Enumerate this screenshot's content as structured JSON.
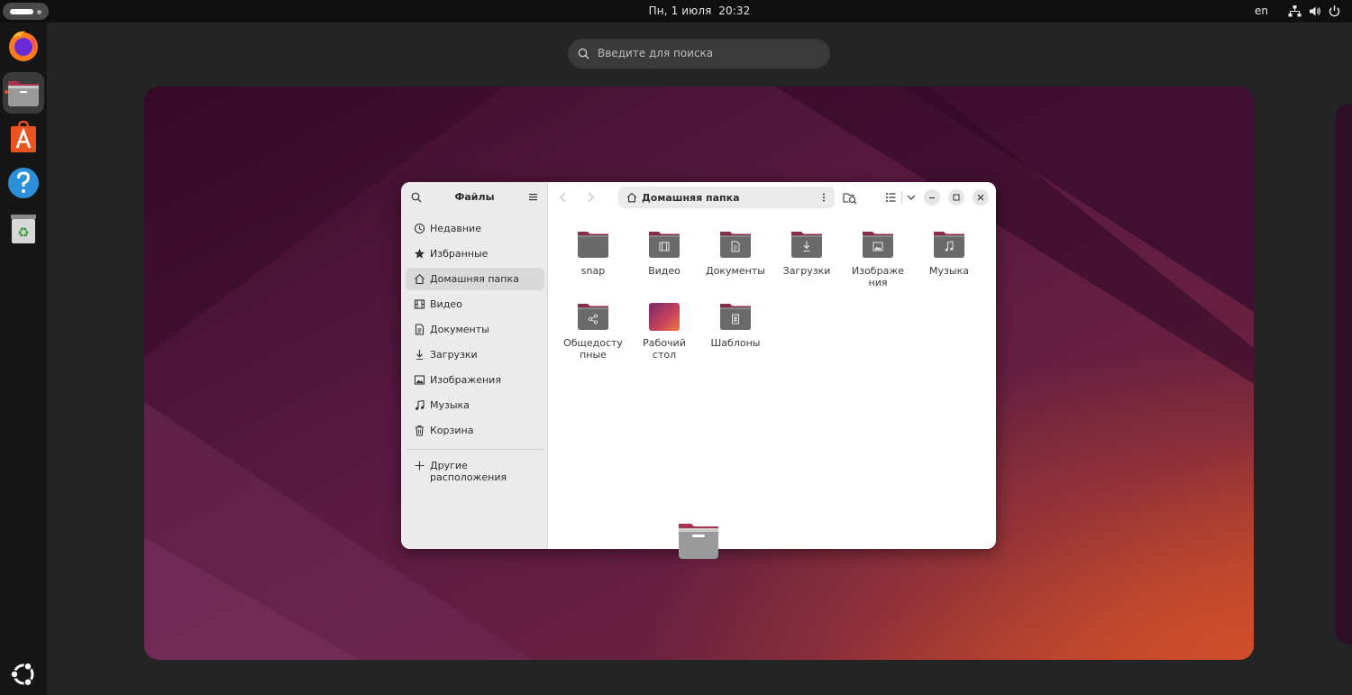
{
  "topbar": {
    "clock": "Пн, 1 июля  20:32",
    "language": "en",
    "tray_icons": [
      "network-icon",
      "volume-icon",
      "power-icon"
    ]
  },
  "dock": {
    "items": [
      {
        "name": "firefox",
        "active": false
      },
      {
        "name": "files",
        "active": true
      },
      {
        "name": "app-center",
        "active": false
      },
      {
        "name": "help",
        "active": false
      },
      {
        "name": "trash",
        "active": false
      }
    ],
    "show_apps_icon": "ubuntu-logo-icon"
  },
  "search": {
    "placeholder": "Введите для поиска"
  },
  "files_window": {
    "sidebar_title": "Файлы",
    "sidebar_items": [
      {
        "label": "Недавние",
        "icon": "clock-icon",
        "selected": false
      },
      {
        "label": "Избранные",
        "icon": "star-icon",
        "selected": false
      },
      {
        "label": "Домашняя папка",
        "icon": "home-icon",
        "selected": true
      },
      {
        "label": "Видео",
        "icon": "video-icon",
        "selected": false
      },
      {
        "label": "Документы",
        "icon": "document-icon",
        "selected": false
      },
      {
        "label": "Загрузки",
        "icon": "download-icon",
        "selected": false
      },
      {
        "label": "Изображения",
        "icon": "image-icon",
        "selected": false
      },
      {
        "label": "Музыка",
        "icon": "music-icon",
        "selected": false
      },
      {
        "label": "Корзина",
        "icon": "trash-icon",
        "selected": false
      }
    ],
    "other_locations": "Другие расположения",
    "path": "Домашняя папка",
    "folders": [
      {
        "label": "snap",
        "emblem": "none"
      },
      {
        "label": "Видео",
        "emblem": "video"
      },
      {
        "label": "Документы",
        "emblem": "document"
      },
      {
        "label": "Загрузки",
        "emblem": "download"
      },
      {
        "label": "Изображе\nния",
        "emblem": "image"
      },
      {
        "label": "Музыка",
        "emblem": "music"
      },
      {
        "label": "Общедосту\nпные",
        "emblem": "share"
      },
      {
        "label": "Рабочий\nстол",
        "emblem": "desktop"
      },
      {
        "label": "Шаблоны",
        "emblem": "template"
      }
    ]
  },
  "colors": {
    "accent": "#e95420",
    "folder_body": "#6a6a6a",
    "folder_tab": "#8c2a49"
  }
}
